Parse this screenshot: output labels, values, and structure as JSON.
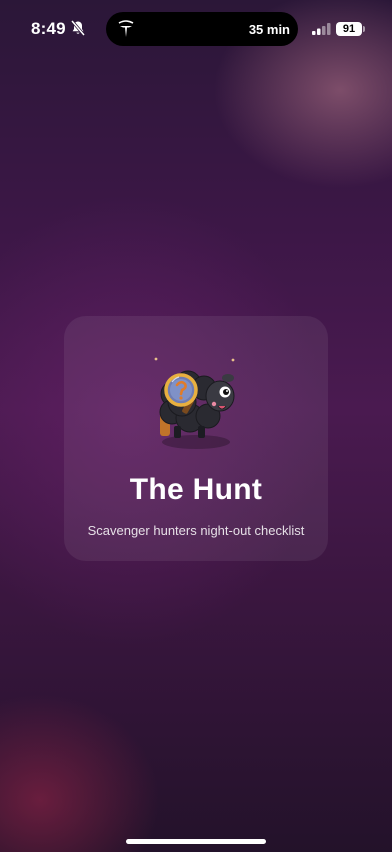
{
  "status_bar": {
    "time": "8:49",
    "live_activity_text": "35 min",
    "battery_level": "91",
    "mute_icon": "bell-slash-icon",
    "signal_icon": "cellular-signal-icon"
  },
  "card": {
    "title": "The Hunt",
    "subtitle": "Scavenger hunters night-out checklist",
    "image": "mascot-with-magnifying-glass"
  },
  "colors": {
    "background_top": "#2b1738",
    "background_mid": "#4a1a50",
    "background_bottom": "#23122a",
    "text": "#ffffff"
  }
}
